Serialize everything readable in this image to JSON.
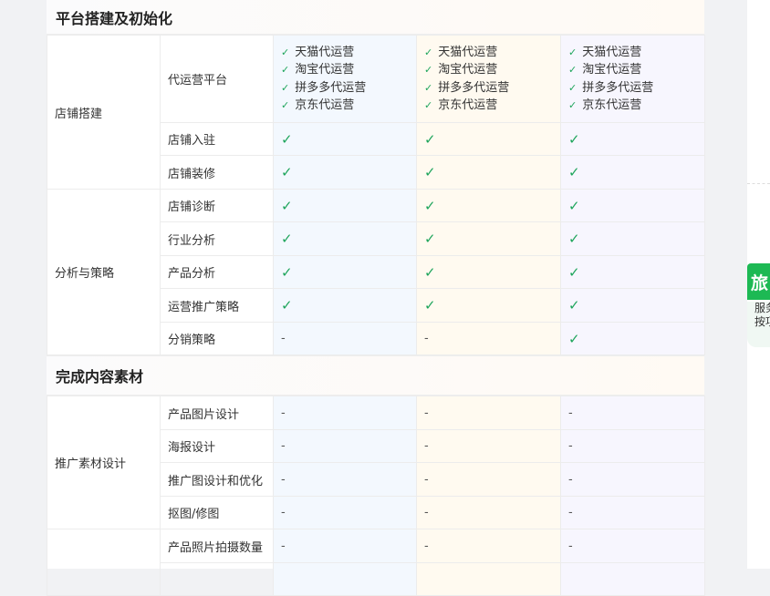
{
  "sections": [
    {
      "title": "平台搭建及初始化",
      "groups": [
        {
          "category": "店铺搭建",
          "rows": [
            {
              "item": "代运营平台",
              "type": "platforms"
            },
            {
              "item": "店铺入驻",
              "values": [
                "check",
                "check",
                "check"
              ]
            },
            {
              "item": "店铺装修",
              "values": [
                "check",
                "check",
                "check"
              ]
            }
          ]
        },
        {
          "category": "分析与策略",
          "rows": [
            {
              "item": "店铺诊断",
              "values": [
                "check",
                "check",
                "check"
              ]
            },
            {
              "item": "行业分析",
              "values": [
                "check",
                "check",
                "check"
              ]
            },
            {
              "item": "产品分析",
              "values": [
                "check",
                "check",
                "check"
              ]
            },
            {
              "item": "运营推广策略",
              "values": [
                "check",
                "check",
                "check"
              ]
            },
            {
              "item": "分销策略",
              "values": [
                "-",
                "-",
                "check"
              ]
            }
          ]
        }
      ]
    },
    {
      "title": "完成内容素材",
      "groups": [
        {
          "category": "推广素材设计",
          "rows": [
            {
              "item": "产品图片设计",
              "values": [
                "-",
                "-",
                "-"
              ]
            },
            {
              "item": "海报设计",
              "values": [
                "-",
                "-",
                "-"
              ]
            },
            {
              "item": "推广图设计和优化",
              "values": [
                "-",
                "-",
                "-"
              ]
            },
            {
              "item": "抠图/修图",
              "values": [
                "-",
                "-",
                "-"
              ]
            }
          ]
        },
        {
          "category": "",
          "rows": [
            {
              "item": "产品照片拍摄数量",
              "values": [
                "-",
                "-",
                "-"
              ]
            },
            {
              "item": "",
              "values": [
                "",
                "",
                ""
              ]
            }
          ]
        }
      ]
    }
  ],
  "platforms": [
    "天猫代运营",
    "淘宝代运营",
    "拼多多代运营",
    "京东代运营"
  ],
  "symbols": {
    "check": "✓",
    "small_check": "✓",
    "dash": "-"
  },
  "side_panel": {
    "tab_label": "旅",
    "text_line1": "服务",
    "text_line2": "按项"
  },
  "colors": {
    "check": "#1fa55c",
    "column1_bg": "#f3f8fe",
    "column2_bg": "#fffaf0",
    "column3_bg": "#f7f6fe",
    "tab_green": "#1db954"
  }
}
